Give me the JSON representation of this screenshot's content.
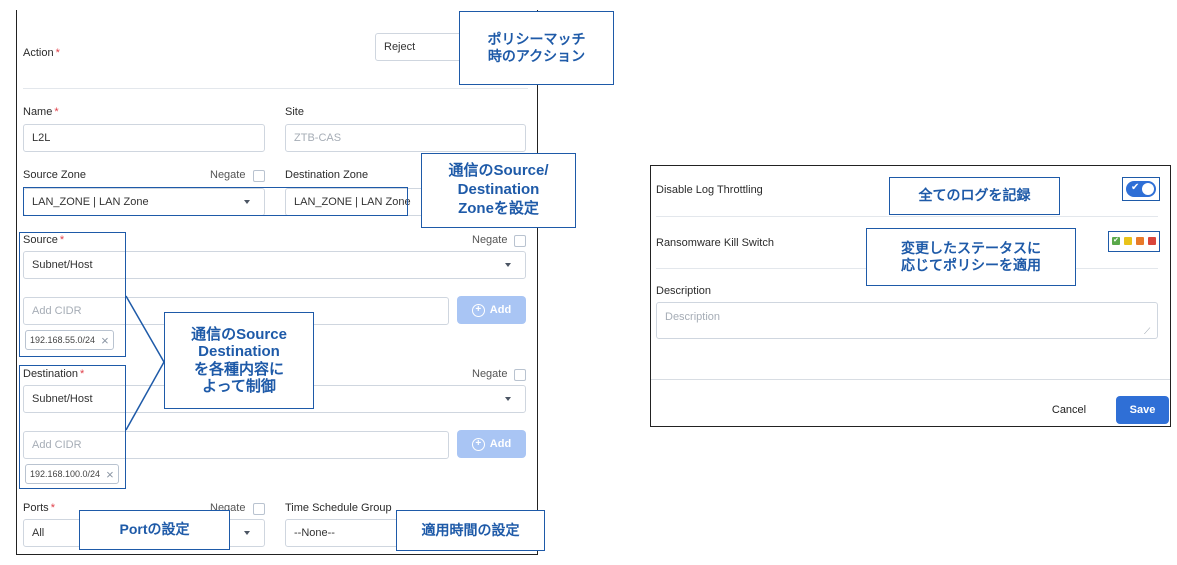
{
  "left_form": {
    "action": {
      "label": "Action",
      "required": "*",
      "value": "Reject"
    },
    "name": {
      "label": "Name",
      "required": "*",
      "value": "L2L"
    },
    "site": {
      "label": "Site",
      "placeholder": "ZTB-CAS"
    },
    "source_zone": {
      "label": "Source Zone",
      "negate": "Negate",
      "value": "LAN_ZONE | LAN Zone"
    },
    "destination_zone": {
      "label": "Destination Zone",
      "value": "LAN_ZONE | LAN Zone"
    },
    "source": {
      "label": "Source",
      "required": "*",
      "negate": "Negate",
      "type": "Subnet/Host",
      "cidr_placeholder": "Add CIDR",
      "add_label": "Add",
      "chip": "192.168.55.0/24"
    },
    "destination": {
      "label": "Destination",
      "required": "*",
      "negate": "Negate",
      "type": "Subnet/Host",
      "cidr_placeholder": "Add CIDR",
      "add_label": "Add",
      "chip": "192.168.100.0/24"
    },
    "ports": {
      "label": "Ports",
      "required": "*",
      "negate": "Negate",
      "value": "All"
    },
    "time_schedule": {
      "label": "Time Schedule Group",
      "value": "--None--"
    }
  },
  "right_panel": {
    "log_throttling": {
      "label": "Disable Log Throttling",
      "enabled": true
    },
    "kill_switch": {
      "label": "Ransomware Kill Switch",
      "colors": [
        "#5aa84a",
        "#e9c31b",
        "#e87a2a",
        "#d9453b"
      ]
    },
    "description": {
      "label": "Description",
      "placeholder": "Description"
    },
    "cancel_label": "Cancel",
    "save_label": "Save"
  },
  "callouts": {
    "action": "ポリシーマッチ\n時のアクション",
    "zone": "通信のSource/\nDestination\nZoneを設定",
    "source_dest": "通信のSource\nDestination\nを各種内容に\nよって制御",
    "ports": "Portの設定",
    "time": "適用時間の設定",
    "log": "全てのログを記録",
    "kill": "変更したステータスに\n応じてポリシーを適用"
  },
  "colors": {
    "accent": "#1e5aa8",
    "primary": "#2f6fd6"
  }
}
